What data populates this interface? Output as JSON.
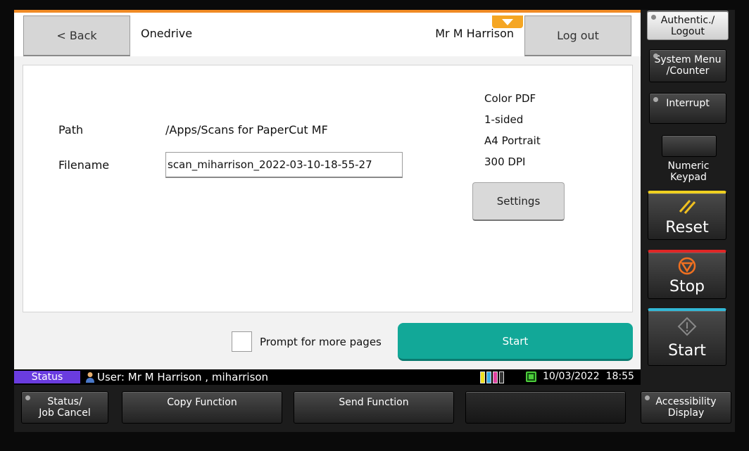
{
  "topbar": {
    "back_label": "< Back",
    "title": "Onedrive",
    "user_name": "Mr M Harrison",
    "logout_label": "Log out"
  },
  "form": {
    "path_label": "Path",
    "path_value": "/Apps/Scans for PaperCut MF",
    "filename_label": "Filename",
    "filename_value": "scan_miharrison_2022-03-10-18-55-27"
  },
  "scan_settings": {
    "specs": [
      "Color PDF",
      "1-sided",
      "A4 Portrait",
      "300 DPI"
    ],
    "settings_label": "Settings"
  },
  "footer": {
    "prompt_label": "Prompt for more pages",
    "prompt_checked": false,
    "start_label": "Start"
  },
  "statusbar": {
    "status_label": "Status",
    "user_line": "User: Mr M Harrison , miharrison",
    "date": "10/03/2022",
    "time": "18:55"
  },
  "hardware": {
    "auth_line1": "Authentic./",
    "auth_line2": "Logout",
    "system_menu_line1": "System Menu",
    "system_menu_line2": "/Counter",
    "interrupt_label": "Interrupt",
    "numeric_line1": "Numeric",
    "numeric_line2": "Keypad",
    "reset_label": "Reset",
    "stop_label": "Stop",
    "start_label": "Start",
    "status_line1": "Status/",
    "status_line2": "Job Cancel",
    "copy_label": "Copy Function",
    "send_label": "Send Function",
    "access_line1": "Accessibility",
    "access_line2": "Display"
  },
  "colors": {
    "accent_orange": "#f08a24",
    "start_teal": "#12a898",
    "status_purple": "#6a3ce0",
    "reset_yellow": "#f0d020",
    "stop_red": "#e02626",
    "start_cyan": "#32b8d6"
  },
  "icons": {
    "pull_tab": "chevron-down-icon",
    "user": "user-icon",
    "toner": "toner-level-icon",
    "network": "network-icon",
    "reset": "reset-icon",
    "stop": "stop-icon",
    "start": "start-icon"
  }
}
